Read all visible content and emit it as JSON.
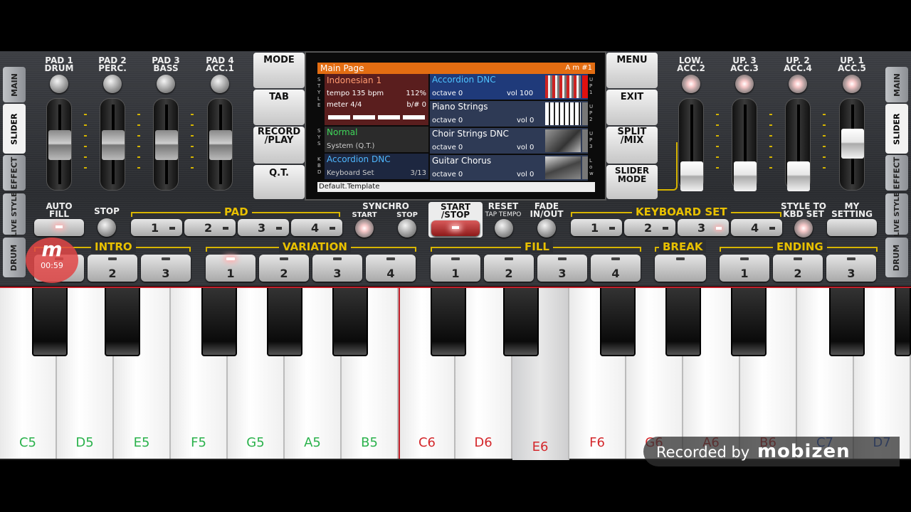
{
  "side_tabs_left": [
    "MAIN",
    "SLIDER",
    "EFFECT",
    "LIVE STYLE",
    "DRUM"
  ],
  "side_tabs_right": [
    "MAIN",
    "SLIDER",
    "EFFECT",
    "LIVE STYLE",
    "DRUM"
  ],
  "pads_left": [
    {
      "label": "PAD 1\nDRUM"
    },
    {
      "label": "PAD 2\nPERC."
    },
    {
      "label": "PAD 3\nBASS"
    },
    {
      "label": "PAD 4\nACC.1"
    }
  ],
  "pads_right": [
    {
      "label": "LOW.\nACC.2"
    },
    {
      "label": "UP. 3\nACC.3"
    },
    {
      "label": "UP. 2\nACC.4"
    },
    {
      "label": "UP. 1\nACC.5"
    }
  ],
  "menu_left": [
    "MODE",
    "TAB",
    "RECORD\n/PLAY",
    "Q.T."
  ],
  "menu_right": [
    "MENU",
    "EXIT",
    "SPLIT\n/MIX",
    "SLIDER\nMODE"
  ],
  "screen": {
    "header": "Main Page",
    "chord": "A m #1",
    "style_name": "Indonesian 1",
    "tempo": "tempo 135 bpm",
    "tempo_pct": "112%",
    "meter": "meter 4/4",
    "bsharp": "b/# 0",
    "sys_name": "Normal",
    "sys_sub": "System (Q.T.)",
    "kbd_name": "Accordion DNC",
    "kbd_sub": "Keyboard Set",
    "kbd_count": "3/13",
    "voices": [
      {
        "name": "Accordion DNC",
        "octave": "octave 0",
        "vol": "vol 100",
        "highlight": true
      },
      {
        "name": "Piano Strings",
        "octave": "octave 0",
        "vol": "vol 0"
      },
      {
        "name": "Choir Strings DNC",
        "octave": "octave 0",
        "vol": "vol 0"
      },
      {
        "name": "Guitar Chorus",
        "octave": "octave 0",
        "vol": "vol 0"
      }
    ],
    "vlabels": {
      "style": "STYLE",
      "sys": "SYS",
      "kbd": "KBD",
      "up1": "UP1",
      "up2": "UP2",
      "up3": "UP3",
      "low": "Low"
    },
    "footer": "Default.Template"
  },
  "controls": {
    "auto_fill": "AUTO\nFILL",
    "stop": "STOP",
    "pad": "PAD",
    "pad_buttons": [
      "1",
      "2",
      "3",
      "4"
    ],
    "synchro": "SYNCHRO",
    "sync_start": "START",
    "sync_stop": "STOP",
    "start_stop": "START\n/STOP",
    "reset": "RESET",
    "tap_tempo": "TAP TEMPO",
    "fade": "FADE\nIN/OUT",
    "keyboard_set": "KEYBOARD SET",
    "kbd_buttons": [
      "1",
      "2",
      "3",
      "4"
    ],
    "style_to_kbd": "STYLE TO\nKBD SET",
    "my_setting": "MY\nSETTING"
  },
  "sections": {
    "intro": {
      "label": "INTRO",
      "buttons": [
        "1",
        "2",
        "3"
      ]
    },
    "variation": {
      "label": "VARIATION",
      "buttons": [
        "1",
        "2",
        "3",
        "4"
      ]
    },
    "fill": {
      "label": "FILL",
      "buttons": [
        "1",
        "2",
        "3",
        "4"
      ]
    },
    "break": {
      "label": "BREAK"
    },
    "ending": {
      "label": "ENDING",
      "buttons": [
        "1",
        "2",
        "3"
      ]
    }
  },
  "recorder": {
    "timer": "00:59",
    "watermark": "Recorded by"
  },
  "keys": [
    {
      "note": "C5",
      "color": "#2bb24c"
    },
    {
      "note": "D5",
      "color": "#2bb24c"
    },
    {
      "note": "E5",
      "color": "#2bb24c"
    },
    {
      "note": "F5",
      "color": "#2bb24c"
    },
    {
      "note": "G5",
      "color": "#2bb24c"
    },
    {
      "note": "A5",
      "color": "#2bb24c"
    },
    {
      "note": "B5",
      "color": "#2bb24c"
    },
    {
      "note": "C6",
      "color": "#d4282c"
    },
    {
      "note": "D6",
      "color": "#d4282c"
    },
    {
      "note": "E6",
      "color": "#d4282c"
    },
    {
      "note": "F6",
      "color": "#d4282c"
    },
    {
      "note": "G6",
      "color": "#d4282c"
    },
    {
      "note": "A6",
      "color": "#d4282c"
    },
    {
      "note": "B6",
      "color": "#d4282c"
    },
    {
      "note": "C7",
      "color": "#2c5fd8"
    },
    {
      "note": "D7",
      "color": "#2c5fd8"
    }
  ]
}
